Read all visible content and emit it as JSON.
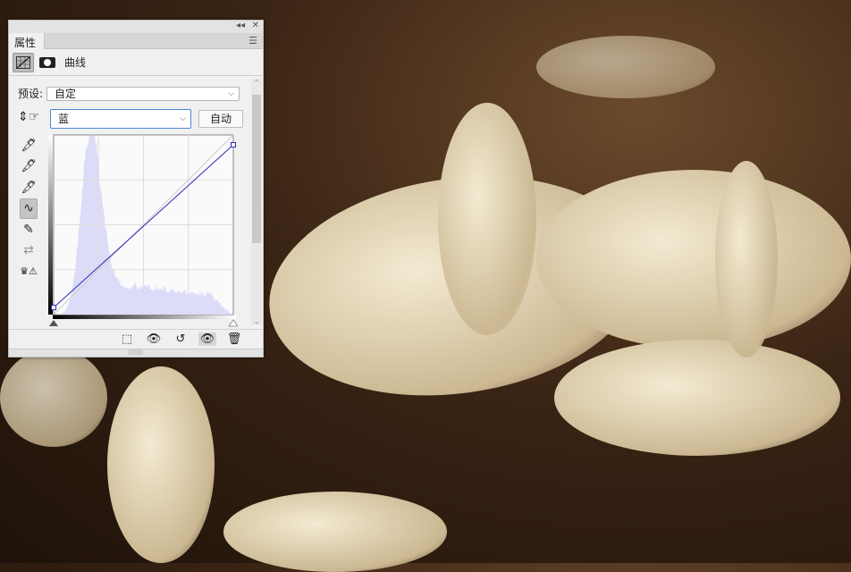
{
  "panel": {
    "title": "属性",
    "header_label": "曲线",
    "preset_label": "预设:",
    "preset_value": "自定",
    "channel_value": "蓝",
    "auto_button": "自动"
  },
  "curve": {
    "channel_color": "#2b2bb8",
    "points": [
      [
        0,
        10
      ],
      [
        255,
        241
      ]
    ]
  },
  "colors": {
    "histogram": "#dcdcf8",
    "panel_bg": "#f0f0f0"
  }
}
